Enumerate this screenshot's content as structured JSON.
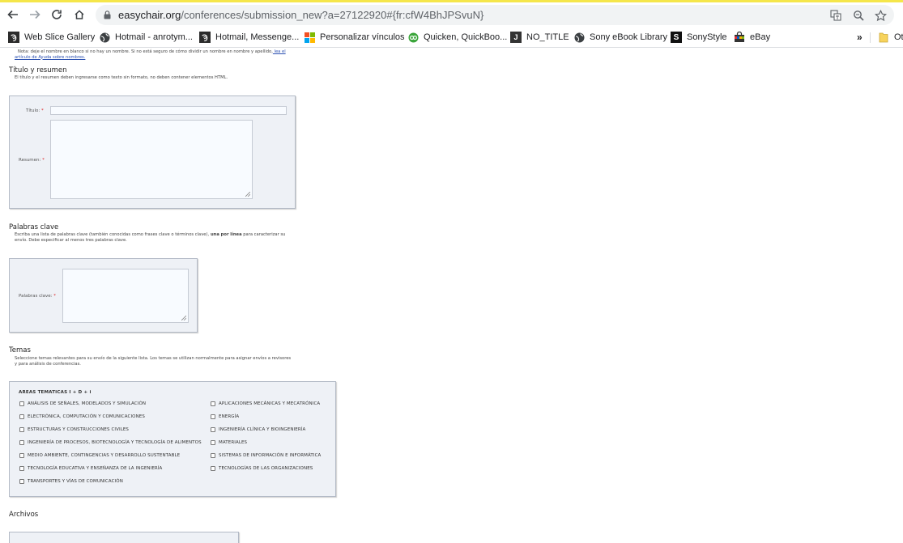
{
  "browser": {
    "url_host": "easychair.org",
    "url_path": "/conferences/submission_new?a=27122920#{fr:cfW4BhJPSvuN}",
    "bookmarks": [
      {
        "label": "Web Slice Gallery",
        "icon": "web-slice-icon"
      },
      {
        "label": "Hotmail - anrotym...",
        "icon": "globe-icon"
      },
      {
        "label": "Hotmail, Messenge...",
        "icon": "web-slice-icon"
      },
      {
        "label": "Personalizar vínculos",
        "icon": "windows-icon"
      },
      {
        "label": "Quicken, QuickBoo...",
        "icon": "quicken-icon"
      },
      {
        "label": "NO_TITLE",
        "icon": "j-icon"
      },
      {
        "label": "Sony eBook Library",
        "icon": "globe-icon"
      },
      {
        "label": "SonyStyle",
        "icon": "s-icon"
      },
      {
        "label": "eBay",
        "icon": "shopping-icon"
      }
    ],
    "overflow_label": "»",
    "other_bookmarks_label": "Ot"
  },
  "page": {
    "note_line1": "Nota: deje el nombre en blanco si no hay un nombre. Si no está seguro de cómo dividir un nombre en nombre y apellido,",
    "note_link1": " lea el",
    "note_link2": "artículo de Ayuda sobre nombres.",
    "title_section": {
      "heading": "Título y resumen",
      "desc": "El título y el resumen deben ingresarse como texto sin formato, no deben contener elementos HTML.",
      "title_label": "Título:",
      "abstract_label": "Resumen:",
      "required_mark": "*"
    },
    "keywords_section": {
      "heading": "Palabras clave",
      "desc_line1_a": "Escriba una lista de palabras clave (también conocidas como frases clave o términos clave),",
      "desc_line1_bold": " una por línea",
      "desc_line1_b": " para caracterizar su",
      "desc_line2": "envío. Debe especificar al menos tres palabras clave.",
      "keywords_label": "Palabras clave:",
      "required_mark": "*"
    },
    "topics_section": {
      "heading": "Temas",
      "desc_line1": "Seleccione temas relevantes para su envío de la siguiente lista. Los temas se utilizan normalmente para asignar envíos a revisores",
      "desc_line2": "y para análisis de conferencias.",
      "group_title": "AREAS TEMATICAS I + D + i",
      "topics_left": [
        "ANÁLISIS DE SEÑALES, MODELADOS Y SIMULACIÓN",
        "ELECTRÓNICA, COMPUTACIÓN Y COMUNICACIONES",
        "ESTRUCTURAS Y CONSTRUCCIONES CIVILES",
        "INGENIERÍA DE PROCESOS, BIOTECNOLOGÍA Y TECNOLOGÍA DE ALIMENTOS",
        "MEDIO AMBIENTE, CONTINGENCIAS Y DESARROLLO SUSTENTABLE",
        "TECNOLOGÍA EDUCATIVA Y ENSEÑANZA DE LA INGENIERÍA",
        "TRANSPORTES Y VÍAS DE COMUNICACIÓN"
      ],
      "topics_right": [
        "APLICACIONES MECÁNICAS Y MECATRÓNICA",
        "ENERGÍA",
        "INGENIERÍA CLÍNICA Y BIOINGENIERÍA",
        "MATERIALES",
        "SISTEMAS DE INFORMACIÓN E INFORMÁTICA",
        "TECNOLOGÍAS DE LAS ORGANIZACIONES"
      ]
    },
    "files_section": {
      "heading": "Archivos"
    }
  }
}
